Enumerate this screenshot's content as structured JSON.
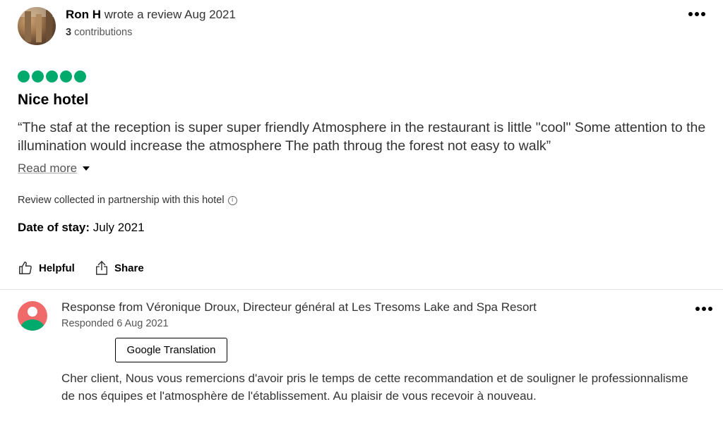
{
  "review": {
    "author_name": "Ron H",
    "author_action": " wrote a review Aug 2021",
    "contributions_count": "3",
    "contributions_label": " contributions",
    "rating_bubbles": 5,
    "rating_max": 5,
    "title": "Nice hotel",
    "text": "“The staf at the reception is super super friendly Atmosphere in the restaurant is little \"cool\" Some attention to the illumination would increase the atmosphere The path throug the forest not easy to walk”",
    "read_more": "Read more",
    "collected_note": "Review collected in partnership with this hotel",
    "date_of_stay_label": "Date of stay:",
    "date_of_stay_value": " July 2021",
    "helpful_label": "Helpful",
    "share_label": "Share"
  },
  "response": {
    "heading": "Response from Véronique Droux, Directeur général at Les Tresoms Lake and Spa Resort",
    "date": "Responded 6 Aug 2021",
    "translate_button": "Google Translation",
    "text": "Cher client, Nous vous remercions d'avoir pris le temps de cette recommandation et de souligner le professionnalisme de nos équipes et l'atmosphère de l'établissement. Au plaisir de vous recevoir à nouveau."
  },
  "colors": {
    "rating_green": "#00aa6c",
    "response_avatar_bg": "#f06a6a"
  },
  "icons": [
    "user-photo-avatar",
    "more-options-icon",
    "info-icon",
    "thumbs-up-icon",
    "share-icon",
    "owner-avatar-icon",
    "caret-down-icon"
  ]
}
